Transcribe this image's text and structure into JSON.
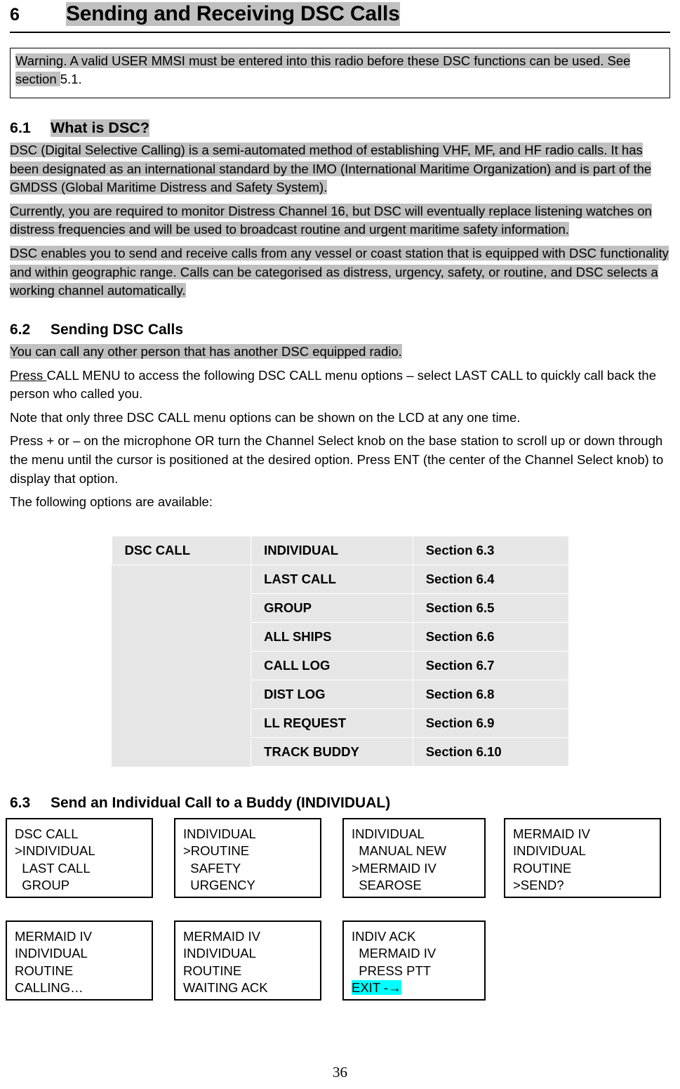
{
  "chapter": {
    "number": "6",
    "title": "Sending and Receiving DSC Calls"
  },
  "warning": {
    "highlighted_text": "Warning. A valid USER MMSI must be entered into this radio before these DSC functions can be used. See section ",
    "plain_text": "5.1."
  },
  "sections": {
    "s61": {
      "number": "6.1",
      "title": "What is DSC?",
      "paragraphs": [
        "DSC (Digital Selective Calling) is a semi-automated method of establishing VHF, MF, and HF radio calls. It has been designated as an international standard by the IMO (International Maritime Organization) and is part of the GMDSS (Global Maritime Distress and Safety System).",
        "Currently, you are required to monitor Distress Channel 16, but DSC will eventually replace listening watches on distress frequencies and will be used to broadcast routine and urgent maritime safety information.",
        "DSC enables you to send and receive calls from any vessel or coast station that is equipped with DSC functionality and within geographic range. Calls can be categorised as distress, urgency, safety, or routine, and DSC selects a working channel automatically."
      ]
    },
    "s62": {
      "number": "6.2",
      "title": "Sending DSC Calls",
      "p1_highlighted": "You can call any other person that has another DSC equipped radio.",
      "p2_underlined": "Press ",
      "p2_rest": "CALL MENU to access the following DSC CALL menu options – select LAST CALL to quickly call back the person who called you.",
      "p3": "Note that only three DSC CALL menu options can be shown on the LCD at any one time.",
      "p4": "Press + or – on the microphone OR turn the Channel Select knob on the base station to scroll up or down through the menu until the cursor is positioned at the desired option. Press ENT (the center of the Channel Select knob) to display that option.",
      "p5": "The following options are available:"
    },
    "s63": {
      "number": "6.3",
      "title": "Send an Individual Call to a Buddy (INDIVIDUAL)"
    }
  },
  "options_table": {
    "menu_label": "DSC CALL",
    "rows": [
      {
        "option": "INDIVIDUAL",
        "section": "Section 6.3"
      },
      {
        "option": "LAST CALL",
        "section": "Section 6.4"
      },
      {
        "option": "GROUP",
        "section": "Section 6.5"
      },
      {
        "option": "ALL SHIPS",
        "section": "Section 6.6"
      },
      {
        "option": "CALL LOG",
        "section": "Section 6.7"
      },
      {
        "option": "DIST LOG",
        "section": "Section 6.8"
      },
      {
        "option": "LL REQUEST",
        "section": "Section 6.9"
      },
      {
        "option": "TRACK BUDDY",
        "section": "Section 6.10"
      }
    ]
  },
  "lcd_screens": {
    "row1": [
      {
        "id": "lcd-1",
        "text": "DSC CALL\n>INDIVIDUAL\n  LAST CALL\n  GROUP"
      },
      {
        "id": "lcd-2",
        "text": "INDIVIDUAL\n>ROUTINE\n  SAFETY\n  URGENCY"
      },
      {
        "id": "lcd-3",
        "text": "INDIVIDUAL\n  MANUAL NEW\n>MERMAID IV\n  SEAROSE"
      },
      {
        "id": "lcd-4",
        "text": "MERMAID IV\nINDIVIDUAL\nROUTINE\n>SEND?"
      }
    ],
    "row2": [
      {
        "id": "lcd-5",
        "text": "MERMAID IV\nINDIVIDUAL\nROUTINE\nCALLING…"
      },
      {
        "id": "lcd-6",
        "text": "MERMAID IV\nINDIVIDUAL\nROUTINE\nWAITING ACK"
      }
    ],
    "lcd7": {
      "id": "lcd-7",
      "line1": "INDIV ACK",
      "line2": "  MERMAID IV",
      "line3": "  PRESS PTT",
      "line4_highlighted": "EXIT -→"
    }
  },
  "page_number": "36",
  "colors": {
    "highlight_gray": "#c0c0c0",
    "table_gray": "#e6e6e6",
    "highlight_cyan": "#00ffff"
  }
}
